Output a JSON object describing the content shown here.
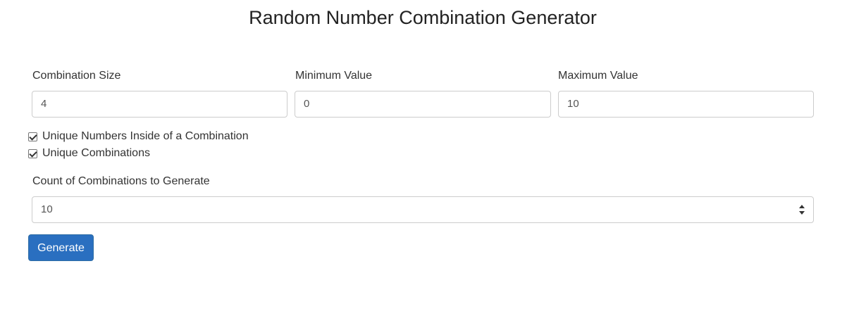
{
  "page_title": "Random Number Combination Generator",
  "fields": {
    "combination_size": {
      "label": "Combination Size",
      "value": "4"
    },
    "minimum_value": {
      "label": "Minimum Value",
      "value": "0"
    },
    "maximum_value": {
      "label": "Maximum Value",
      "value": "10"
    }
  },
  "options": {
    "unique_numbers": {
      "label": "Unique Numbers Inside of a Combination",
      "checked": true
    },
    "unique_combinations": {
      "label": "Unique Combinations",
      "checked": true
    }
  },
  "count": {
    "label": "Count of Combinations to Generate",
    "value": "10"
  },
  "generate_button": {
    "label": "Generate"
  },
  "colors": {
    "primary": "#2a6fc0",
    "border": "#cccccc",
    "text": "#333333"
  }
}
